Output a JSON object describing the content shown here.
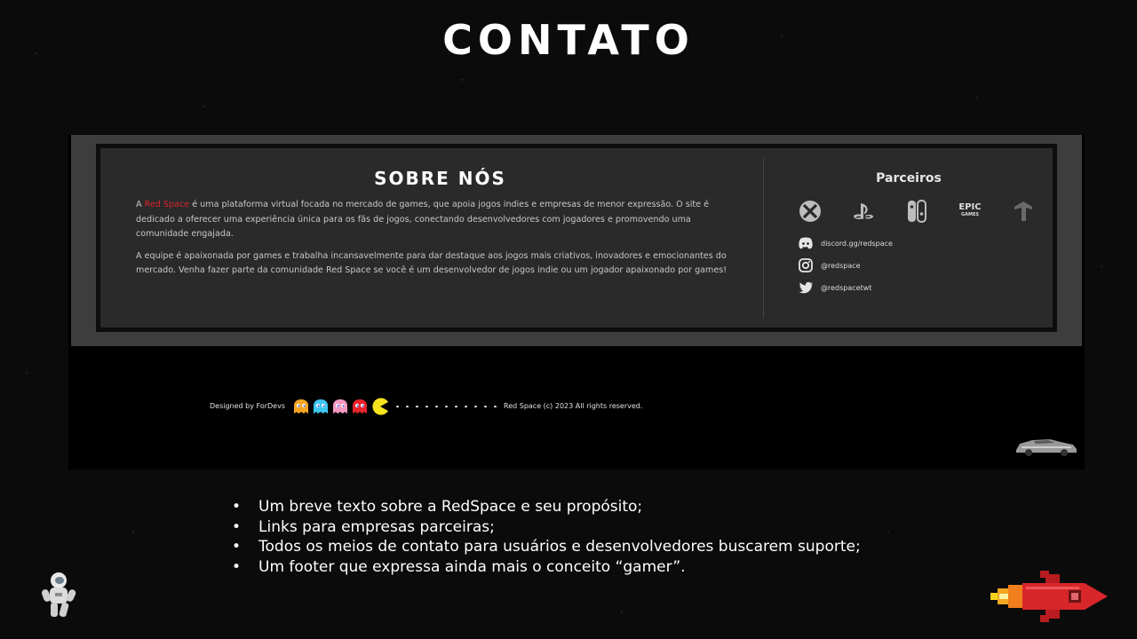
{
  "slide": {
    "title": "CONTATO"
  },
  "about": {
    "title": "SOBRE NÓS",
    "p1_prefix": "A ",
    "p1_brand": "Red Space",
    "p1_rest": " é uma plataforma virtual focada no mercado de games, que apoia jogos indies e empresas de menor expressão. O site é dedicado a oferecer uma experiência única para os fãs de jogos, conectando desenvolvedores com jogadores e promovendo uma comunidade engajada.",
    "p2": "A equipe é apaixonada por games e trabalha incansavelmente para dar destaque aos jogos mais criativos, inovadores e emocionantes do mercado. Venha fazer parte da comunidade Red Space se você é um desenvolvedor de jogos indie ou um jogador apaixonado por games!"
  },
  "partners": {
    "title": "Parceiros",
    "logos": [
      "xbox-icon",
      "playstation-icon",
      "nintendo-switch-icon",
      "epic-games-icon",
      "arrow-up-icon"
    ],
    "epic_line1": "EPIC",
    "epic_line2": "GAMES"
  },
  "contacts": {
    "discord": "discord.gg/redspace",
    "instagram": "@redspace",
    "twitter": "@redspacetwt"
  },
  "footer": {
    "designed_by": "Designed by ForDevs",
    "copyright": "Red Space (c) 2023 All rights reserved.",
    "ghost_colors": [
      "#f5a623",
      "#3ec6f0",
      "#f49ac2",
      "#e8242a"
    ],
    "pacman_color": "#f7e41c"
  },
  "bullets": [
    "Um breve texto sobre a RedSpace e seu propósito;",
    "Links para empresas parceiras;",
    "Todos os meios de contato para usuários e desenvolvedores buscarem suporte;",
    "Um footer que expressa ainda mais o conceito “gamer”."
  ],
  "colors": {
    "accent_red": "#d8262a",
    "panel": "#2a2a2a",
    "frame": "#3d3d3d"
  }
}
